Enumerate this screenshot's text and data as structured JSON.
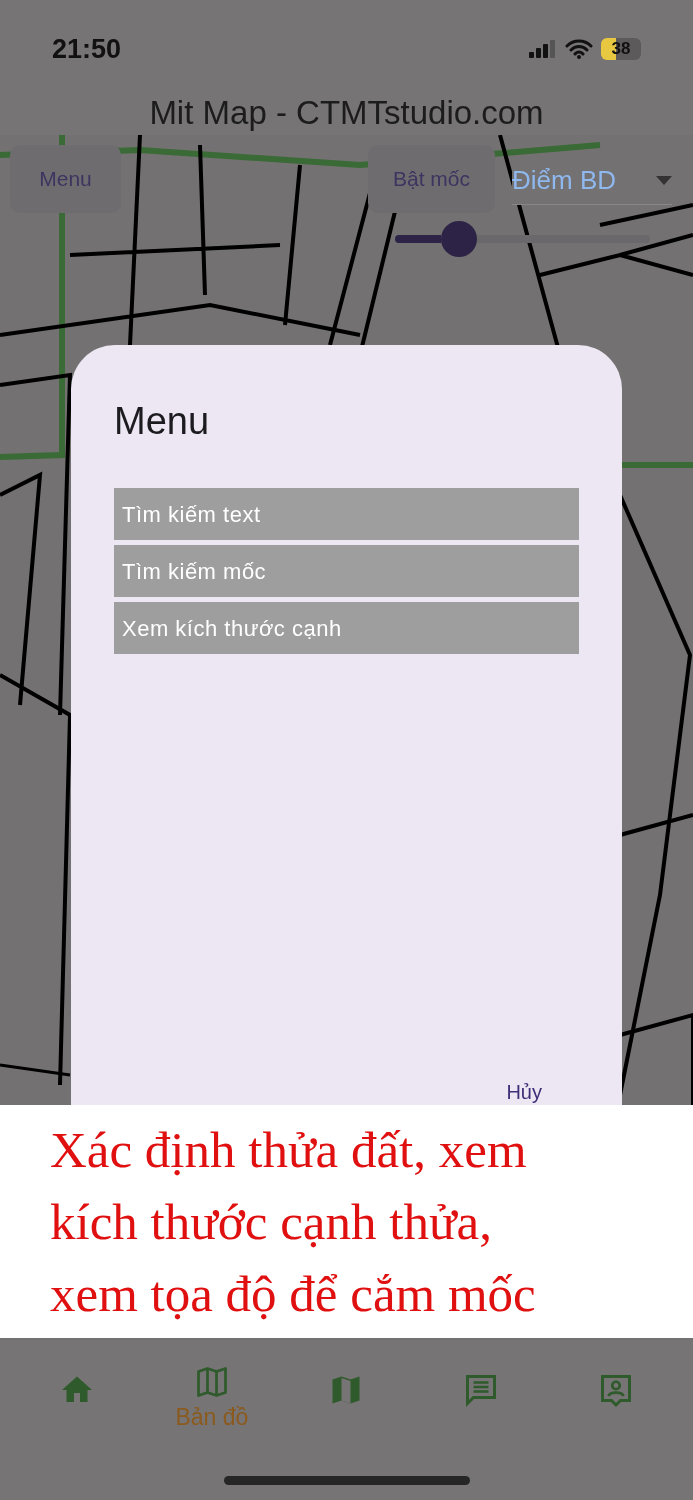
{
  "status_bar": {
    "time": "21:50",
    "battery": "38"
  },
  "app_title": "Mit Map - CTMTstudio.com",
  "toolbar": {
    "menu_button": "Menu",
    "marker_button": "Bật mốc",
    "dropdown": {
      "value": "Điểm BD"
    },
    "slider": {
      "level": 0.25
    }
  },
  "dialog": {
    "title": "Menu",
    "items": [
      {
        "label": "Tìm kiếm text"
      },
      {
        "label": "Tìm kiếm mốc"
      },
      {
        "label": "Xem kích thước cạnh"
      }
    ],
    "cancel": "Hủy"
  },
  "caption": "Xác định thửa đất, xem kích thước cạnh thửa, xem tọa độ để cắm mốc",
  "bottom_nav": [
    {
      "selected": false
    },
    {
      "label": "Bản đồ",
      "selected": true
    },
    {
      "selected": false
    },
    {
      "selected": false
    },
    {
      "selected": false
    }
  ]
}
